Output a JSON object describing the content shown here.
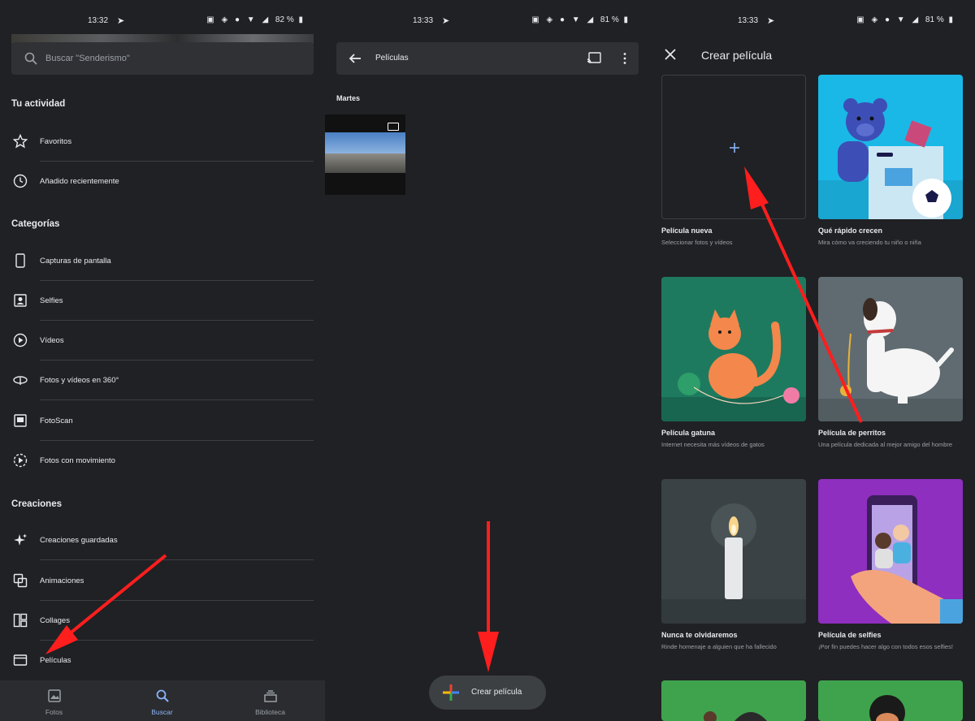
{
  "panel1": {
    "status": {
      "time": "13:32",
      "battery": "82 %"
    },
    "search_placeholder": "Buscar \"Senderismo\"",
    "sections": {
      "activity": "Tu actividad",
      "categories": "Categorías",
      "creations": "Creaciones"
    },
    "activity_items": [
      "Favoritos",
      "Añadido recientemente"
    ],
    "category_items": [
      "Capturas de pantalla",
      "Selfies",
      "Vídeos",
      "Fotos y vídeos en 360°",
      "FotoScan",
      "Fotos con movimiento"
    ],
    "creation_items": [
      "Creaciones guardadas",
      "Animaciones",
      "Collages",
      "Películas"
    ],
    "nav": [
      "Fotos",
      "Buscar",
      "Biblioteca"
    ]
  },
  "panel2": {
    "status": {
      "time": "13:33",
      "battery": "81 %"
    },
    "title": "Películas",
    "day": "Martes",
    "fab_label": "Crear película"
  },
  "panel3": {
    "status": {
      "time": "13:33",
      "battery": "81 %"
    },
    "title": "Crear película",
    "cards": [
      {
        "title": "Película nueva",
        "subtitle": "Seleccionar fotos y vídeos"
      },
      {
        "title": "Qué rápido crecen",
        "subtitle": "Mira cómo va creciendo tu niño o niña"
      },
      {
        "title": "Película gatuna",
        "subtitle": "Internet necesita más vídeos de gatos"
      },
      {
        "title": "Película de perritos",
        "subtitle": "Una película dedicada al mejor amigo del hombre"
      },
      {
        "title": "Nunca te olvidaremos",
        "subtitle": "Rinde homenaje a alguien que ha fallecido"
      },
      {
        "title": "Película de selfies",
        "subtitle": "¡Por fin puedes hacer algo con todos esos selfies!"
      }
    ]
  },
  "colors": {
    "accent": "#8ab4f8",
    "background": "#202124",
    "surface": "#303134",
    "annotation_arrow": "#ff1e1e"
  }
}
